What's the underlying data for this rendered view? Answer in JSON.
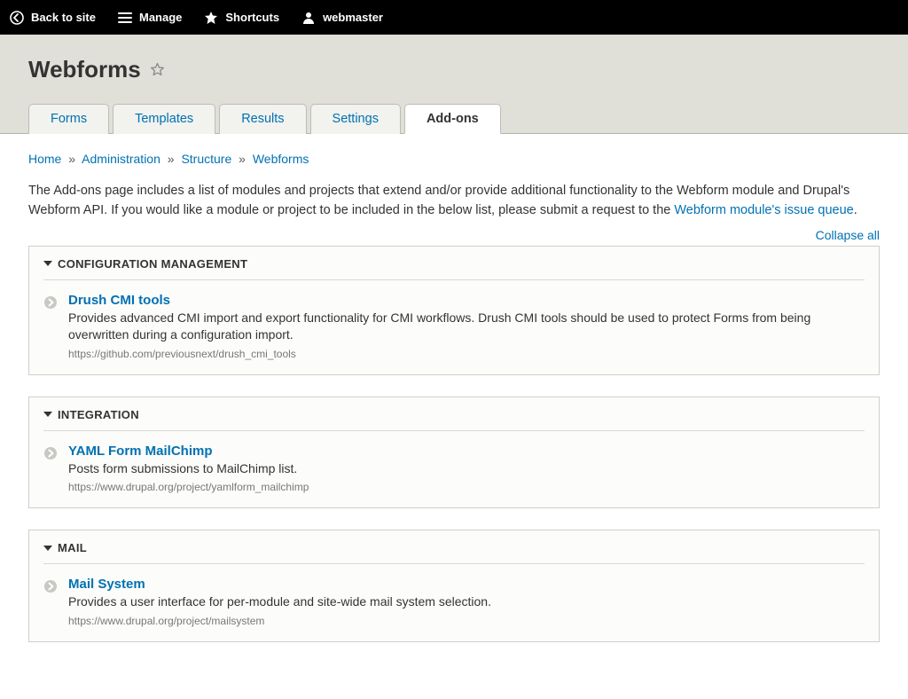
{
  "topbar": {
    "back": "Back to site",
    "manage": "Manage",
    "shortcuts": "Shortcuts",
    "user": "webmaster"
  },
  "page_title": "Webforms",
  "tabs": {
    "forms": "Forms",
    "templates": "Templates",
    "results": "Results",
    "settings": "Settings",
    "addons": "Add-ons"
  },
  "breadcrumb": {
    "home": "Home",
    "admin": "Administration",
    "structure": "Structure",
    "webforms": "Webforms",
    "sep": "»"
  },
  "intro": {
    "text_a": "The Add-ons page includes a list of modules and projects that extend and/or provide additional functionality to the Webform module and Drupal's Webform API. If you would like a module or project to be included in the below list, please submit a request to the ",
    "link": "Webform module's issue queue",
    "text_b": "."
  },
  "collapse_all": "Collapse all",
  "sections": {
    "config": {
      "title": "CONFIGURATION MANAGEMENT",
      "item_title": "Drush CMI tools",
      "item_desc": "Provides advanced CMI import and export functionality for CMI workflows. Drush CMI tools should be used to protect Forms from being overwritten during a configuration import.",
      "item_url": "https://github.com/previousnext/drush_cmi_tools"
    },
    "integration": {
      "title": "INTEGRATION",
      "item_title": "YAML Form MailChimp",
      "item_desc": "Posts form submissions to MailChimp list.",
      "item_url": "https://www.drupal.org/project/yamlform_mailchimp"
    },
    "mail": {
      "title": "MAIL",
      "item_title": "Mail System",
      "item_desc": "Provides a user interface for per-module and site-wide mail system selection.",
      "item_url": "https://www.drupal.org/project/mailsystem"
    }
  }
}
